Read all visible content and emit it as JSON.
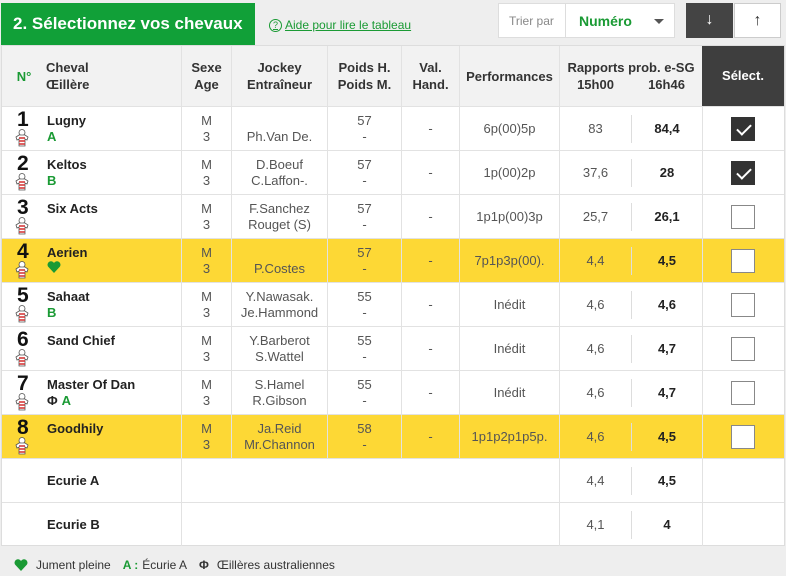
{
  "header": {
    "title": "2. Sélectionnez vos chevaux",
    "help_icon": "?",
    "help_link": "Aide pour lire le tableau",
    "sort_label": "Trier par",
    "sort_value": "Numéro",
    "sort_desc": "↓",
    "sort_asc": "↑"
  },
  "columns": {
    "num": "N°",
    "horse": [
      "Cheval",
      "Œillère"
    ],
    "sex": [
      "Sexe",
      "Age"
    ],
    "jockey": [
      "Jockey",
      "Entraîneur"
    ],
    "weight": [
      "Poids H.",
      "Poids M."
    ],
    "hand": [
      "Val.",
      "Hand."
    ],
    "perf": "Performances",
    "odds_title": "Rapports prob. e-SG",
    "odds_t1": "15h00",
    "odds_t2": "16h46",
    "select": "Sélect."
  },
  "rows": [
    {
      "num": "1",
      "name": "Lugny",
      "sub": "A",
      "sex": "M",
      "age": "3",
      "jockey": "",
      "trainer": "Ph.Van De.",
      "weight": "57",
      "weight2": "-",
      "hand": "-",
      "perf": "6p(00)5p",
      "o1": "83",
      "o2": "84,4",
      "checked": true,
      "highlight": false,
      "jersey_color": "#d32f2f"
    },
    {
      "num": "2",
      "name": "Keltos",
      "sub": "B",
      "sex": "M",
      "age": "3",
      "jockey": "D.Boeuf",
      "trainer": "C.Laffon-.",
      "weight": "57",
      "weight2": "-",
      "hand": "-",
      "perf": "1p(00)2p",
      "o1": "37,6",
      "o2": "28",
      "checked": true,
      "highlight": false,
      "jersey_color": "#d32f2f"
    },
    {
      "num": "3",
      "name": "Six Acts",
      "sub": "",
      "sex": "M",
      "age": "3",
      "jockey": "F.Sanchez",
      "trainer": "Rouget (S)",
      "weight": "57",
      "weight2": "-",
      "hand": "-",
      "perf": "1p1p(00)3p",
      "o1": "25,7",
      "o2": "26,1",
      "checked": false,
      "highlight": false,
      "jersey_color": "#d32f2f"
    },
    {
      "num": "4",
      "name": "Aerien",
      "sub": "heart",
      "sex": "M",
      "age": "3",
      "jockey": "",
      "trainer": "P.Costes",
      "weight": "57",
      "weight2": "-",
      "hand": "-",
      "perf": "7p1p3p(00).",
      "o1": "4,4",
      "o2": "4,5",
      "checked": false,
      "highlight": true,
      "jersey_color": "#d32f2f"
    },
    {
      "num": "5",
      "name": "Sahaat",
      "sub": "B",
      "sex": "M",
      "age": "3",
      "jockey": "Y.Nawasak.",
      "trainer": "Je.Hammond",
      "weight": "55",
      "weight2": "-",
      "hand": "-",
      "perf": "Inédit",
      "o1": "4,6",
      "o2": "4,6",
      "checked": false,
      "highlight": false,
      "jersey_color": "#d32f2f"
    },
    {
      "num": "6",
      "name": "Sand Chief",
      "sub": "",
      "sex": "M",
      "age": "3",
      "jockey": "Y.Barberot",
      "trainer": "S.Wattel",
      "weight": "55",
      "weight2": "-",
      "hand": "-",
      "perf": "Inédit",
      "o1": "4,6",
      "o2": "4,7",
      "checked": false,
      "highlight": false,
      "jersey_color": "#d32f2f"
    },
    {
      "num": "7",
      "name": "Master Of Dan",
      "sub": "ΦA",
      "sex": "M",
      "age": "3",
      "jockey": "S.Hamel",
      "trainer": "R.Gibson",
      "weight": "55",
      "weight2": "-",
      "hand": "-",
      "perf": "Inédit",
      "o1": "4,6",
      "o2": "4,7",
      "checked": false,
      "highlight": false,
      "jersey_color": "#d32f2f"
    },
    {
      "num": "8",
      "name": "Goodhily",
      "sub": "",
      "sex": "M",
      "age": "3",
      "jockey": "Ja.Reid",
      "trainer": "Mr.Channon",
      "weight": "58",
      "weight2": "-",
      "hand": "-",
      "perf": "1p1p2p1p5p.",
      "o1": "4,6",
      "o2": "4,5",
      "checked": false,
      "highlight": true,
      "jersey_color": "#d32f2f"
    }
  ],
  "ecuries": [
    {
      "name": "Ecurie A",
      "o1": "4,4",
      "o2": "4,5"
    },
    {
      "name": "Ecurie B",
      "o1": "4,1",
      "o2": "4"
    }
  ],
  "legend": {
    "heart": "Jument pleine",
    "a_key": "A :",
    "a_text": "Écurie A",
    "blinker": "Œillères australiennes"
  },
  "colors": {
    "green": "#11a038",
    "yellow": "#fdd835",
    "dark": "#3e3e3e"
  }
}
